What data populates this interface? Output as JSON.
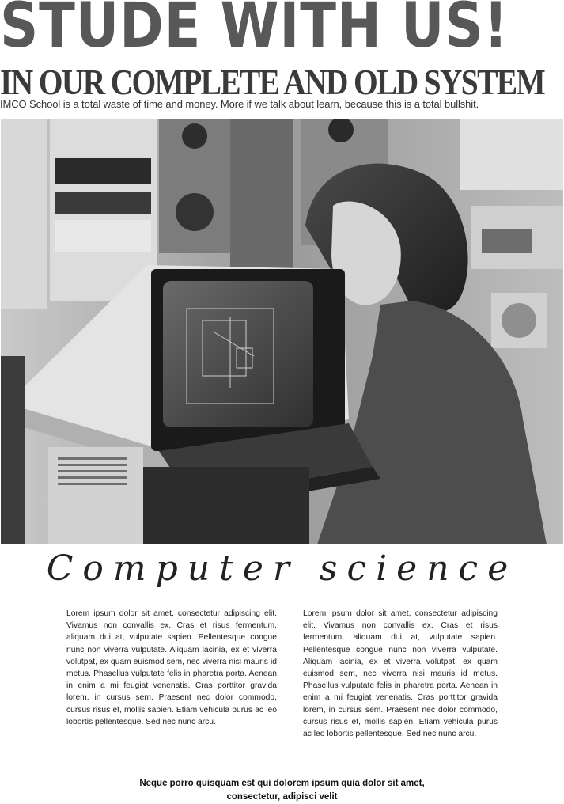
{
  "poster": {
    "headline": "STUDE WITH US!",
    "subhead": "IN OUR COMPLETE AND OLD SYSTEM",
    "tagline": "IMCO School is a total waste of time and money. More if we talk about learn, because this is a total bullshit.",
    "section_title": "Computer science",
    "column_left": "Lorem ipsum dolor sit amet, consectetur adipiscing elit. Vivamus non convallis ex. Cras et risus fermentum, aliquam dui at, vulputate sapien. Pellentesque congue nunc non viverra vulputate. Aliquam lacinia, ex et viverra volutpat, ex quam euismod sem, nec viverra nisi mauris id metus. Phasellus vulputate felis in pharetra porta. Aenean in enim a mi feugiat venenatis. Cras porttitor gravida lorem, in cursus sem. Praesent nec dolor commodo, cursus risus et, mollis sapien. Etiam vehicula purus ac leo lobortis pellentesque. Sed nec nunc arcu.",
    "column_right": "Lorem ipsum dolor sit amet, consectetur adipiscing elit. Vivamus non convallis ex. Cras et risus fermentum, aliquam dui at, vulputate sapien. Pellentesque congue nunc non viverra vulputate. Aliquam lacinia, ex et viverra volutpat, ex quam euismod sem, nec viverra nisi mauris id metus. Phasellus vulputate felis in pharetra porta. Aenean in enim a mi feugiat venenatis. Cras porttitor gravida lorem, in cursus sem. Praesent nec dolor commodo, cursus risus et, mollis sapien. Etiam vehicula purus ac leo lobortis pellentesque. Sed nec nunc arcu.",
    "footer_quote": "Neque porro quisquam est qui dolorem ipsum quia dolor sit amet, consectetur, adipisci velit"
  },
  "colors": {
    "headline": "#585858",
    "subhead": "#3a3a3a",
    "photo_base": "#8a8a8a"
  }
}
